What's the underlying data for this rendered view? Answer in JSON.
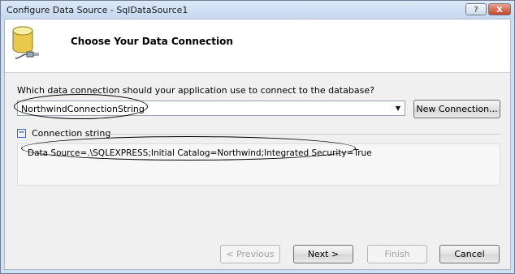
{
  "window": {
    "title": "Configure Data Source - SqlDataSource1",
    "help_label": "?",
    "close_label": "X"
  },
  "header": {
    "title": "Choose Your Data Connection",
    "icon": "database-connection-icon"
  },
  "question": "Which data connection should your application use to connect to the database?",
  "connection_select": {
    "value": "NorthwindConnectionString"
  },
  "new_connection_label": "New Connection...",
  "connection_string": {
    "toggle": "−",
    "label": "Connection string",
    "value": "Data Source=.\\SQLEXPRESS;Initial Catalog=Northwind;Integrated Security=True"
  },
  "buttons": {
    "previous": "< Previous",
    "next": "Next >",
    "finish": "Finish",
    "cancel": "Cancel"
  }
}
